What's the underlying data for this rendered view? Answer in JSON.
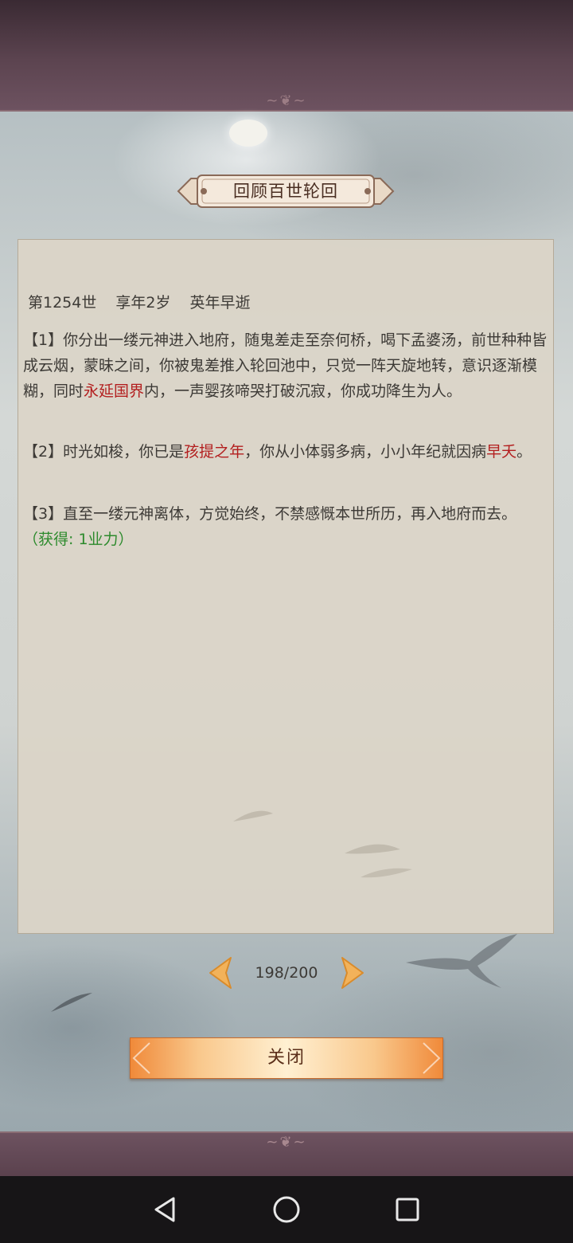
{
  "dialog": {
    "title": "回顾百世轮回"
  },
  "record": {
    "generation": "第1254世",
    "age": "享年2岁",
    "fate": "英年早逝",
    "paragraphs": [
      {
        "a": "【1】你分出一缕元神进入地府，随鬼差走至奈何桥，喝下孟婆汤，前世种种皆成云烟，蒙昧之间，你被鬼差推入轮回池中，只觉一阵天旋地转，意识逐渐模糊，同时",
        "hl": "永延国界",
        "b": "内，一声婴孩啼哭打破沉寂，你成功降生为人。"
      },
      {
        "a": "【2】时光如梭，你已是",
        "hl": "孩提之年",
        "b": "，你从小体弱多病，小小年纪就因病",
        "hl2": "早夭",
        "c": "。"
      },
      {
        "a": "【3】直至一缕元神离体，方觉始终，不禁感慨本世所历，再入地府而去。",
        "reward": "（获得: 1业力）"
      }
    ]
  },
  "pager": {
    "current": "198/200"
  },
  "buttons": {
    "close": "关闭"
  },
  "colors": {
    "highlight": "#b31f1f",
    "reward": "#2c8a2c",
    "text": "#3d3a36"
  },
  "icons": {
    "prev": "chevron-left-icon",
    "next": "chevron-right-icon",
    "back": "triangle-back-icon",
    "home": "circle-home-icon",
    "recent": "square-recent-icon"
  }
}
